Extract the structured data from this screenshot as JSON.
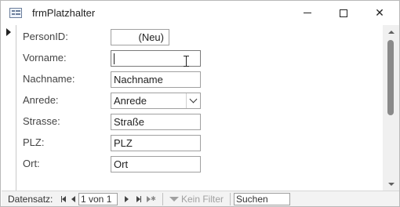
{
  "window": {
    "title": "frmPlatzhalter"
  },
  "fields": [
    {
      "label": "PersonID:",
      "value": "(Neu)"
    },
    {
      "label": "Vorname:",
      "value": ""
    },
    {
      "label": "Nachname:",
      "value": "Nachname"
    },
    {
      "label": "Anrede:",
      "value": "Anrede"
    },
    {
      "label": "Strasse:",
      "value": "Straße"
    },
    {
      "label": "PLZ:",
      "value": "PLZ"
    },
    {
      "label": "Ort:",
      "value": "Ort"
    }
  ],
  "navigation": {
    "label": "Datensatz:",
    "record": "1 von 1",
    "filter_label": "Kein Filter",
    "search_placeholder": "Suchen"
  },
  "icons": {
    "app": "form-icon",
    "record_selector": "current-record-arrow-icon",
    "cursor": "text-ibeam-icon"
  },
  "colors": {
    "border": "#a0a0a0",
    "navbar_bg": "#f3f3f3",
    "disabled_text": "#a0a0a0"
  }
}
